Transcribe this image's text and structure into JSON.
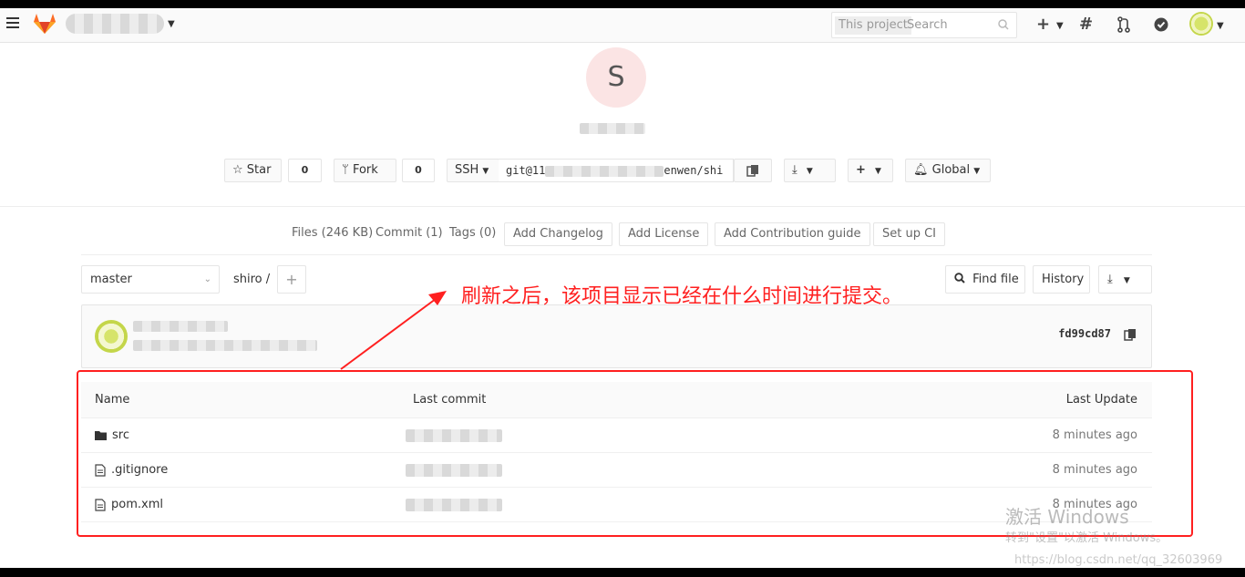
{
  "header": {
    "search_scope": "This project",
    "search_placeholder": "Search"
  },
  "project": {
    "avatar_letter": "S",
    "star_label": "Star",
    "star_count": "0",
    "fork_label": "Fork",
    "fork_count": "0",
    "clone_protocol": "SSH",
    "clone_url_start": "git@11",
    "clone_url_end": "enwen/shi",
    "notification_label": "Global"
  },
  "stats": {
    "files": "Files (246 KB)",
    "commits": "Commit (1)",
    "tags": "Tags (0)",
    "add_changelog": "Add Changelog",
    "add_license": "Add License",
    "add_contribution": "Add Contribution guide",
    "setup_ci": "Set up CI"
  },
  "tree": {
    "branch": "master",
    "path": "shiro",
    "path_sep": "/",
    "find_file": "Find file",
    "history": "History"
  },
  "commit": {
    "sha": "fd99cd87"
  },
  "table": {
    "headers": {
      "name": "Name",
      "last_commit": "Last commit",
      "last_update": "Last Update"
    },
    "rows": [
      {
        "name": "src",
        "type": "folder",
        "updated": "8 minutes ago"
      },
      {
        "name": ".gitignore",
        "type": "file",
        "updated": "8 minutes ago"
      },
      {
        "name": "pom.xml",
        "type": "file",
        "updated": "8 minutes ago"
      }
    ]
  },
  "annotation": {
    "text": "刷新之后，该项目显示已经在什么时间进行提交。",
    "color": "#ff2020"
  },
  "watermark": {
    "activate_title": "激活 Windows",
    "activate_sub": "转到\"设置\"以激活 Windows。",
    "url": "https://blog.csdn.net/qq_32603969"
  }
}
